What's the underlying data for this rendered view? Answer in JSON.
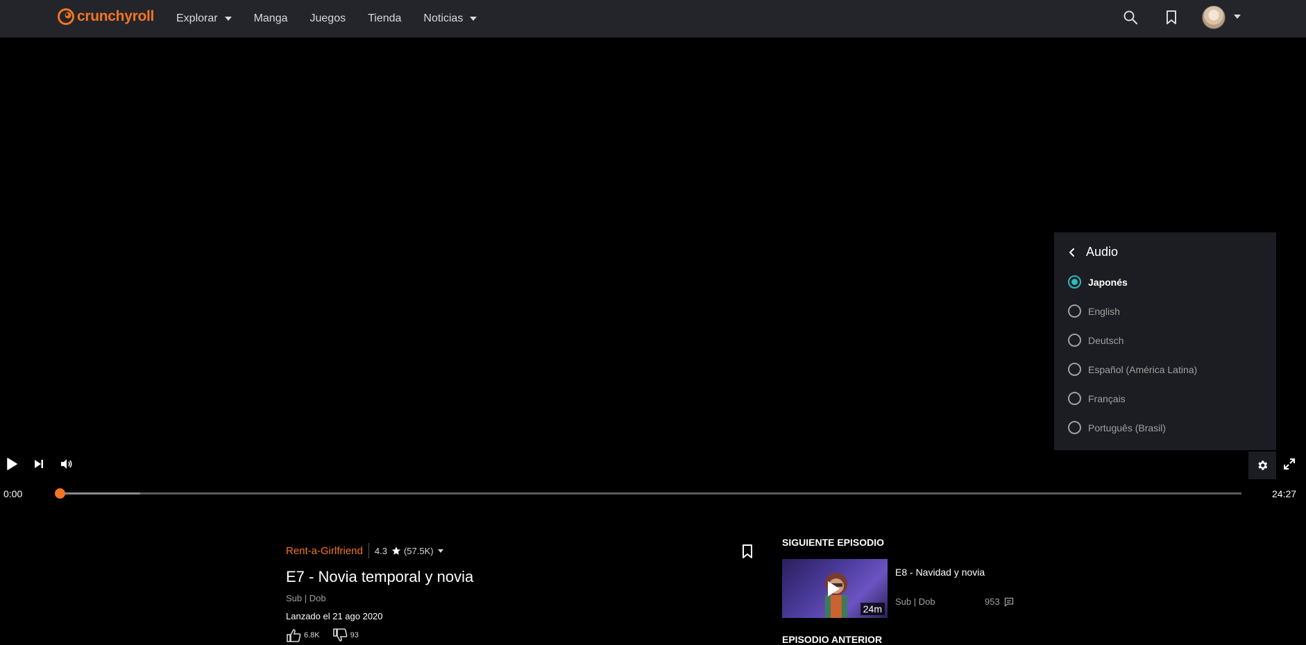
{
  "brand": {
    "name": "crunchyroll",
    "color": "#f47521"
  },
  "nav": {
    "items": [
      {
        "label": "Explorar",
        "dropdown": true
      },
      {
        "label": "Manga",
        "dropdown": false
      },
      {
        "label": "Juegos",
        "dropdown": false
      },
      {
        "label": "Tienda",
        "dropdown": false
      },
      {
        "label": "Noticias",
        "dropdown": true
      }
    ]
  },
  "header_icons": [
    "search-icon",
    "bookmark-icon",
    "avatar",
    "chevron-down-icon"
  ],
  "player": {
    "current_time": "0:00",
    "duration": "24:27",
    "progress_fraction": 0.0,
    "controls": [
      "play-icon",
      "skip-next-icon",
      "volume-icon",
      "gear-icon",
      "fullscreen-icon"
    ]
  },
  "audio_menu": {
    "title": "Audio",
    "options": [
      {
        "label": "Japonés",
        "selected": true
      },
      {
        "label": "English",
        "selected": false
      },
      {
        "label": "Deutsch",
        "selected": false
      },
      {
        "label": "Español (América Latina)",
        "selected": false
      },
      {
        "label": "Français",
        "selected": false
      },
      {
        "label": "Português (Brasil)",
        "selected": false
      }
    ],
    "accent": "#2abdbb"
  },
  "episode": {
    "series": "Rent-a-Girlfriend",
    "rating": "4.3",
    "rating_count": "(57.5K)",
    "title": "E7 - Novia temporal y novia",
    "sub_dub": "Sub | Dob",
    "release": "Lanzado el 21 ago 2020",
    "likes": "6.8K",
    "dislikes": "93"
  },
  "next_episode": {
    "heading": "SIGUIENTE EPISODIO",
    "title": "E8 - Navidad y novia",
    "sub_dub": "Sub | Dob",
    "comments": "953",
    "duration": "24m"
  },
  "previous_episode": {
    "heading": "EPISODIO ANTERIOR"
  }
}
